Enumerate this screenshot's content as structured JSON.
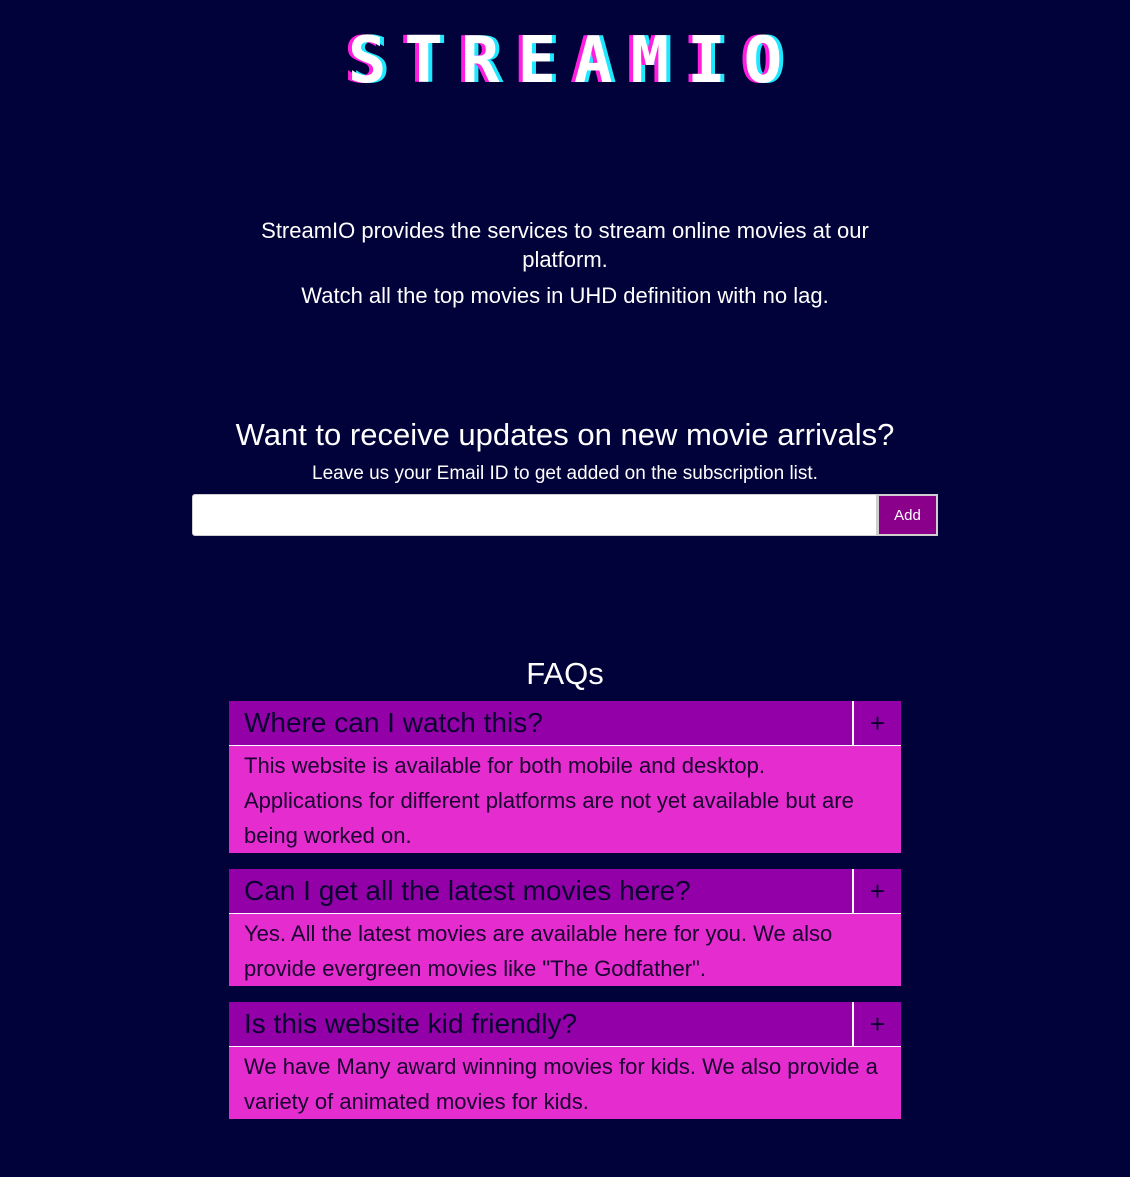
{
  "header": {
    "logo_text": "STREAMIO"
  },
  "intro": {
    "line1": "StreamIO provides the services to stream online movies at our platform.",
    "line2": "Watch all the top movies in UHD definition with no lag."
  },
  "subscribe": {
    "title": "Want to receive updates on new movie arrivals?",
    "subtitle": "Leave us your Email ID to get added on the subscription list.",
    "email_value": "",
    "email_placeholder": "",
    "add_label": "Add"
  },
  "faq": {
    "title": "FAQs",
    "toggle_symbol": "+",
    "items": [
      {
        "question": "Where can I watch this?",
        "answer": "This website is available for both mobile and desktop. Applications for different platforms are not yet available but are being worked on."
      },
      {
        "question": "Can I get all the latest movies here?",
        "answer": "Yes. All the latest movies are available here for you. We also provide evergreen movies like \"The Godfather\"."
      },
      {
        "question": "Is this website kid friendly?",
        "answer": "We have Many award winning movies for kids. We also provide a variety of animated movies for kids."
      }
    ]
  },
  "colors": {
    "background": "#02023a",
    "faq_question_bg": "#9400a8",
    "faq_answer_bg": "#e52ccf",
    "button_bg": "#8a008a",
    "logo_glow_left": "#ff1ee0",
    "logo_glow_right": "#1ee8ff"
  }
}
